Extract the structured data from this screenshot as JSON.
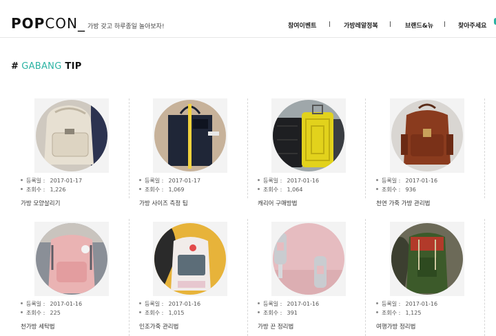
{
  "brand": {
    "name_bold": "POP",
    "name_light": "CON_",
    "tagline": "가방 갖고 하루종일 놀아보자!"
  },
  "nav": [
    "참여이벤트",
    "가방레알정복",
    "브랜드&뉴",
    "찾아주세요"
  ],
  "section": {
    "hash": "#",
    "accent": "GABANG",
    "label": "TIP"
  },
  "labels": {
    "date": "등록일 :",
    "views": "조회수 :"
  },
  "items": [
    {
      "date": "2017-01-17",
      "views": "1,226",
      "title": "가방 모양살리기",
      "image": "beige-backpack"
    },
    {
      "date": "2017-01-17",
      "views": "1,069",
      "title": "가방 사이즈 측정 팁",
      "image": "tote-with-ruler"
    },
    {
      "date": "2017-01-16",
      "views": "1,064",
      "title": "캐리어 구매방법",
      "image": "suitcases"
    },
    {
      "date": "2017-01-16",
      "views": "936",
      "title": "천연 가죽 가방 관리법",
      "image": "leather-backpack"
    },
    {
      "date": "2017-01-16",
      "views": "225",
      "title": "천가방 세탁법",
      "image": "pink-backpack"
    },
    {
      "date": "2017-01-16",
      "views": "1,015",
      "title": "인조가죽 관리법",
      "image": "white-backpack"
    },
    {
      "date": "2017-01-16",
      "views": "391",
      "title": "가방 끈 정리법",
      "image": "strap-buckles"
    },
    {
      "date": "2017-01-16",
      "views": "1,125",
      "title": "여행가방 정리법",
      "image": "green-hiking-backpack"
    }
  ],
  "colors": {
    "accent": "#2bb3a3"
  }
}
